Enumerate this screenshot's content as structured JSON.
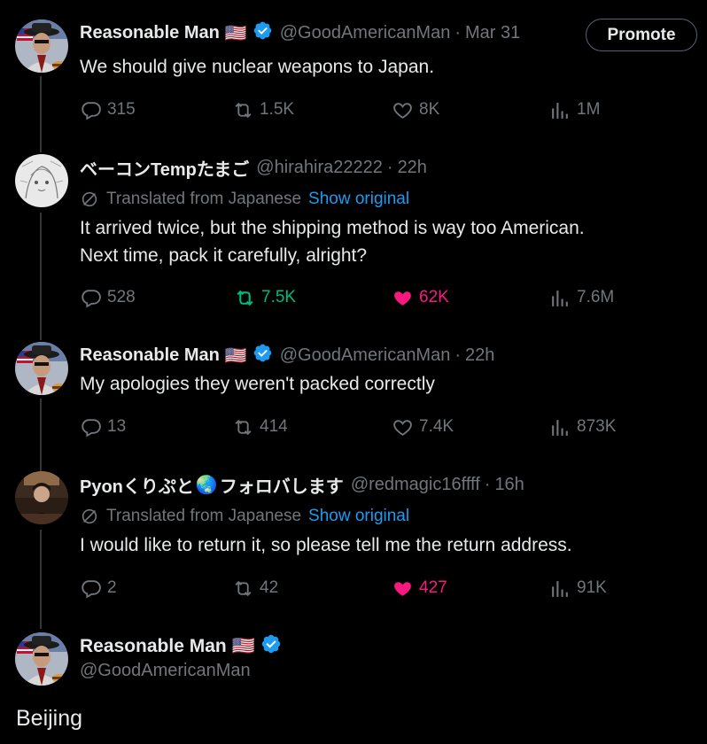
{
  "promote_label": "Promote",
  "tweets": [
    {
      "name": "Reasonable Man",
      "flag": "🇺🇸",
      "handle": "@GoodAmericanMan",
      "dot": "·",
      "time": "Mar 31",
      "text": "We should give nuclear weapons to Japan.",
      "replies": "315",
      "retweets": "1.5K",
      "likes": "8K",
      "views": "1M"
    },
    {
      "name": "ベーコンTempたまご",
      "handle": "@hirahira22222",
      "dot": "·",
      "time": "22h",
      "translated_label": "Translated from Japanese",
      "show_original": "Show original",
      "text_line1": "It arrived twice, but the shipping method is way too American.",
      "text_line2": "Next time, pack it carefully, alright?",
      "replies": "528",
      "retweets": "7.5K",
      "likes": "62K",
      "views": "7.6M"
    },
    {
      "name": "Reasonable Man",
      "flag": "🇺🇸",
      "handle": "@GoodAmericanMan",
      "dot": "·",
      "time": "22h",
      "text": "My apologies they weren't packed correctly",
      "replies": "13",
      "retweets": "414",
      "likes": "7.4K",
      "views": "873K"
    },
    {
      "name": "Pyonくりぷと",
      "name_emoji": "🌏",
      "name_suffix": "フォロバします",
      "handle": "@redmagic16ffff",
      "dot": "·",
      "time": "16h",
      "translated_label": "Translated from Japanese",
      "show_original": "Show original",
      "text": "I would like to return it, so please tell me the return address.",
      "replies": "2",
      "retweets": "42",
      "likes": "427",
      "views": "91K"
    }
  ],
  "main": {
    "name": "Reasonable Man",
    "flag": "🇺🇸",
    "handle": "@GoodAmericanMan",
    "text": "Beijing"
  },
  "colors": {
    "background": "#000000",
    "text": "#e7e9ea",
    "muted": "#71767b",
    "link": "#1d9bf0",
    "retweet_active": "#00ba7c",
    "like_active": "#f91880",
    "verified": "#1d9bf0"
  }
}
